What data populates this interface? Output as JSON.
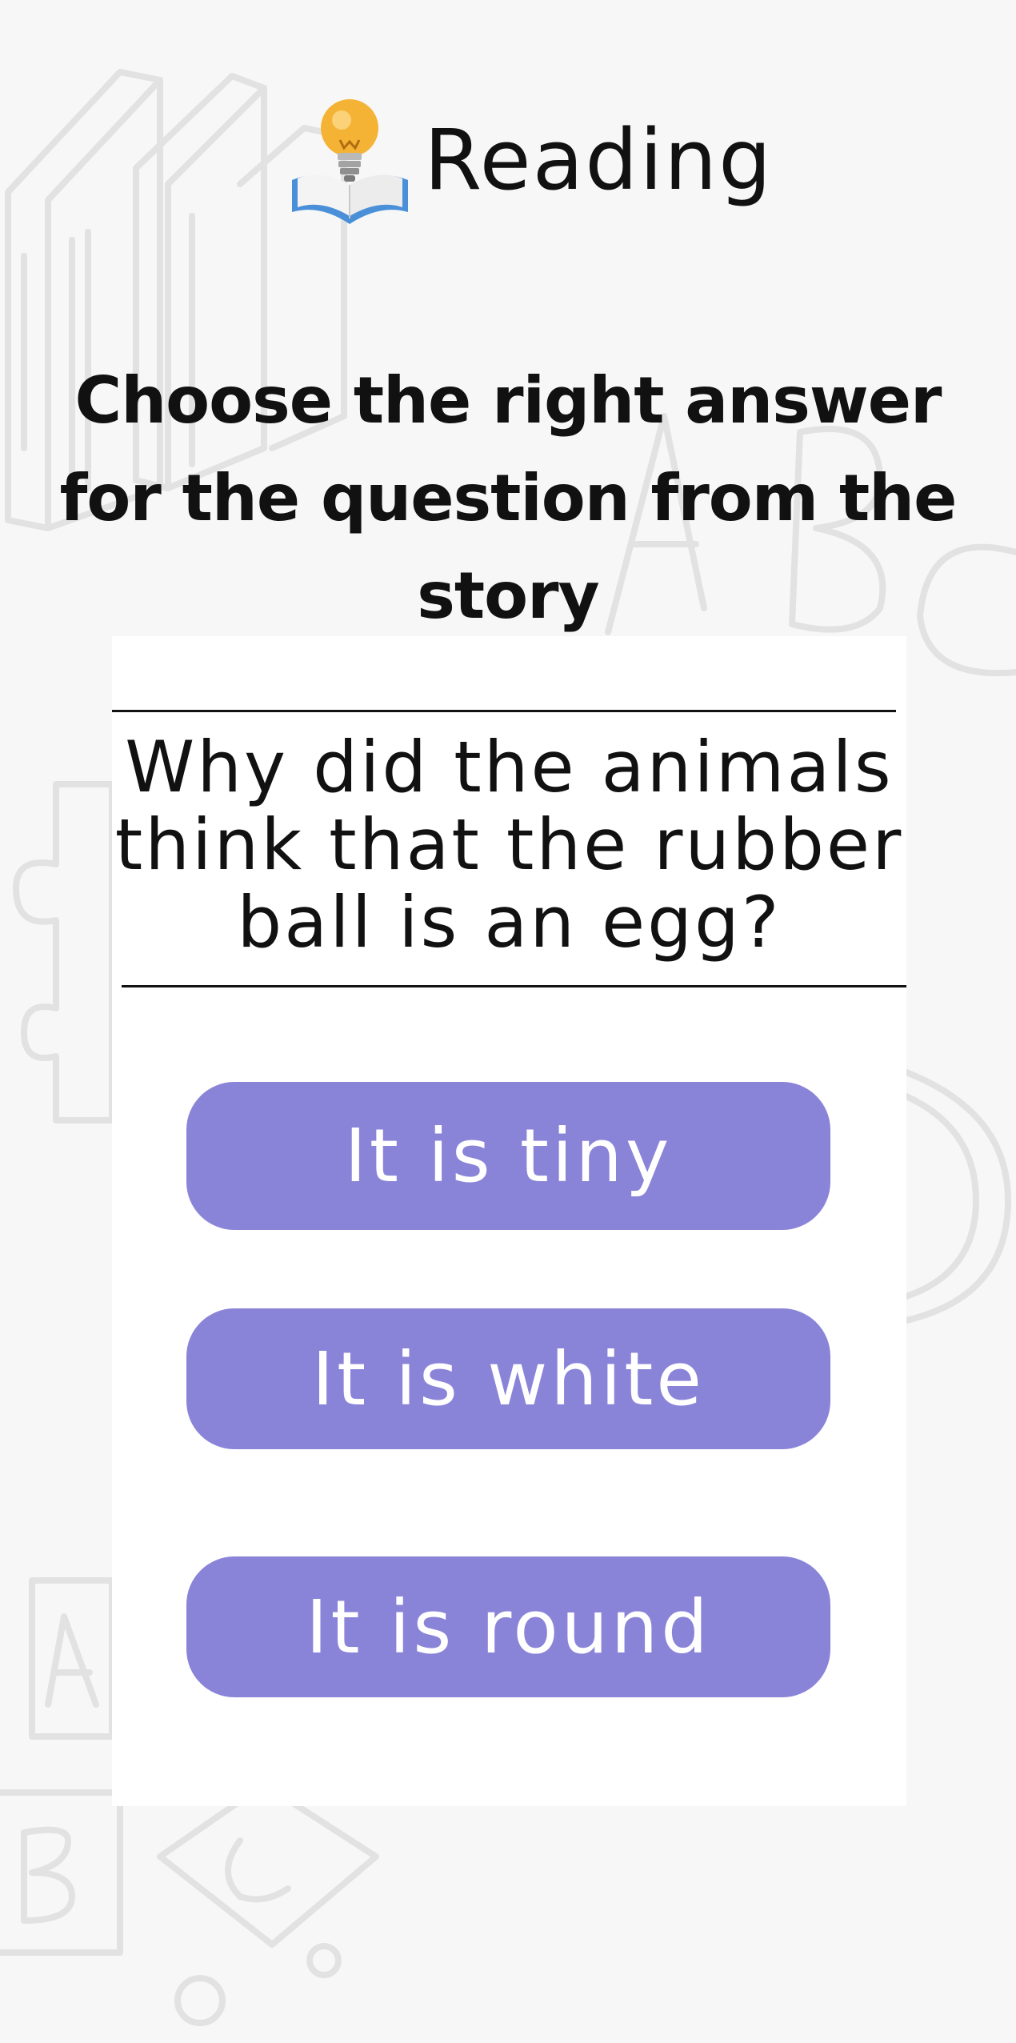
{
  "header": {
    "title": "Reading",
    "icon": "lightbulb-book-icon"
  },
  "instruction": "Choose the right answer for the question from the story",
  "quiz": {
    "question": "Why did the animals think that the rubber ball is an egg?",
    "answers": [
      {
        "label": "It is tiny"
      },
      {
        "label": "It is white"
      },
      {
        "label": "It is round"
      }
    ]
  },
  "colors": {
    "background": "#f7f7f7",
    "card": "#ffffff",
    "answer_button": "#8a84d8",
    "text": "#111111",
    "doodle": "#e2e2e2"
  }
}
